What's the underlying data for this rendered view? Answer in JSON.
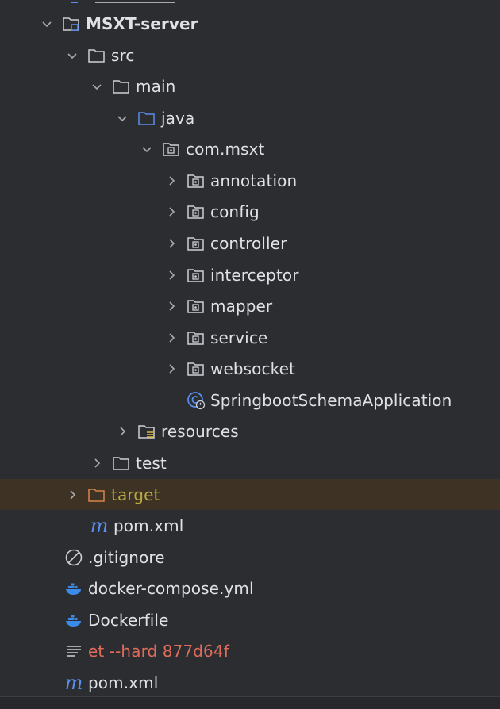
{
  "project_tree": {
    "items": [
      {
        "label": "MSXT-server",
        "icon": "module-folder-icon",
        "expanded": true
      },
      {
        "label": "src",
        "icon": "folder-icon",
        "expanded": true
      },
      {
        "label": "main",
        "icon": "folder-icon",
        "expanded": true
      },
      {
        "label": "java",
        "icon": "source-folder-icon",
        "expanded": true
      },
      {
        "label": "com.msxt",
        "icon": "package-icon",
        "expanded": true
      },
      {
        "label": "annotation",
        "icon": "package-icon",
        "expanded": false
      },
      {
        "label": "config",
        "icon": "package-icon",
        "expanded": false
      },
      {
        "label": "controller",
        "icon": "package-icon",
        "expanded": false
      },
      {
        "label": "interceptor",
        "icon": "package-icon",
        "expanded": false
      },
      {
        "label": "mapper",
        "icon": "package-icon",
        "expanded": false
      },
      {
        "label": "service",
        "icon": "package-icon",
        "expanded": false
      },
      {
        "label": "websocket",
        "icon": "package-icon",
        "expanded": false
      },
      {
        "label": "SpringbootSchemaApplication",
        "icon": "spring-boot-class-icon"
      },
      {
        "label": "resources",
        "icon": "resources-folder-icon",
        "expanded": false
      },
      {
        "label": "test",
        "icon": "folder-icon",
        "expanded": false
      },
      {
        "label": "target",
        "icon": "excluded-folder-icon",
        "expanded": false,
        "highlighted": true
      },
      {
        "label": "pom.xml",
        "icon": "maven-icon"
      },
      {
        "label": ".gitignore",
        "icon": "ignore-file-icon"
      },
      {
        "label": "docker-compose.yml",
        "icon": "docker-icon"
      },
      {
        "label": "Dockerfile",
        "icon": "docker-icon"
      },
      {
        "label": "et --hard 877d64f",
        "icon": "text-file-icon"
      },
      {
        "label": "pom.xml",
        "icon": "maven-icon"
      }
    ]
  },
  "colors": {
    "background": "#2b2d30",
    "text": "#dfe1e5",
    "accent_blue": "#5a8dee",
    "highlight_row": "#3d3223",
    "excluded_orange": "#d9834a",
    "excluded_text": "#b9a845",
    "untracked_red": "#e06c5c"
  }
}
